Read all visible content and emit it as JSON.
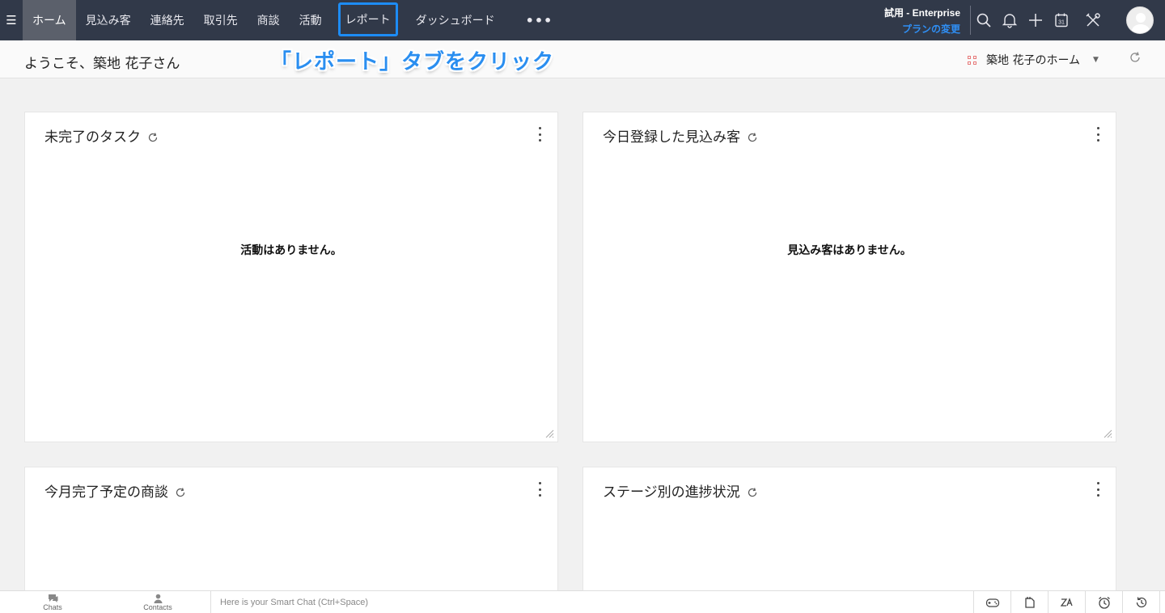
{
  "nav": {
    "menu_icon": "hamburger-icon",
    "tabs": [
      {
        "label": "ホーム"
      },
      {
        "label": "見込み客"
      },
      {
        "label": "連絡先"
      },
      {
        "label": "取引先"
      },
      {
        "label": "商談"
      },
      {
        "label": "活動"
      },
      {
        "label": "レポート"
      },
      {
        "label": "ダッシュボード"
      }
    ],
    "more_label": "•••",
    "plan_name": "試用 - Enterprise",
    "plan_change": "プランの変更",
    "icons": [
      "search-icon",
      "bell-icon",
      "plus-icon",
      "calendar-icon",
      "setup-tools-icon",
      "avatar"
    ],
    "calendar_day": "31"
  },
  "subheader": {
    "welcome": "ようこそ、築地 花子さん",
    "annotation": "「レポート」タブをクリック",
    "home_selector": "築地 花子のホーム"
  },
  "cards": [
    {
      "title": "未完了のタスク",
      "empty_message": "活動はありません。"
    },
    {
      "title": "今日登録した見込み客",
      "empty_message": "見込み客はありません。"
    },
    {
      "title": "今月完了予定の商談",
      "empty_message": ""
    },
    {
      "title": "ステージ別の進捗状況",
      "empty_message": ""
    }
  ],
  "bottombar": {
    "chats_label": "Chats",
    "contacts_label": "Contacts",
    "smart_chat_placeholder": "Here is your Smart Chat (Ctrl+Space)"
  },
  "colors": {
    "topbar_bg": "#313949",
    "active_tab_bg": "#5b606b",
    "highlight_border": "#1d8cf5",
    "accent_blue": "#2f8ff5",
    "page_bg": "#f1f1f1"
  }
}
